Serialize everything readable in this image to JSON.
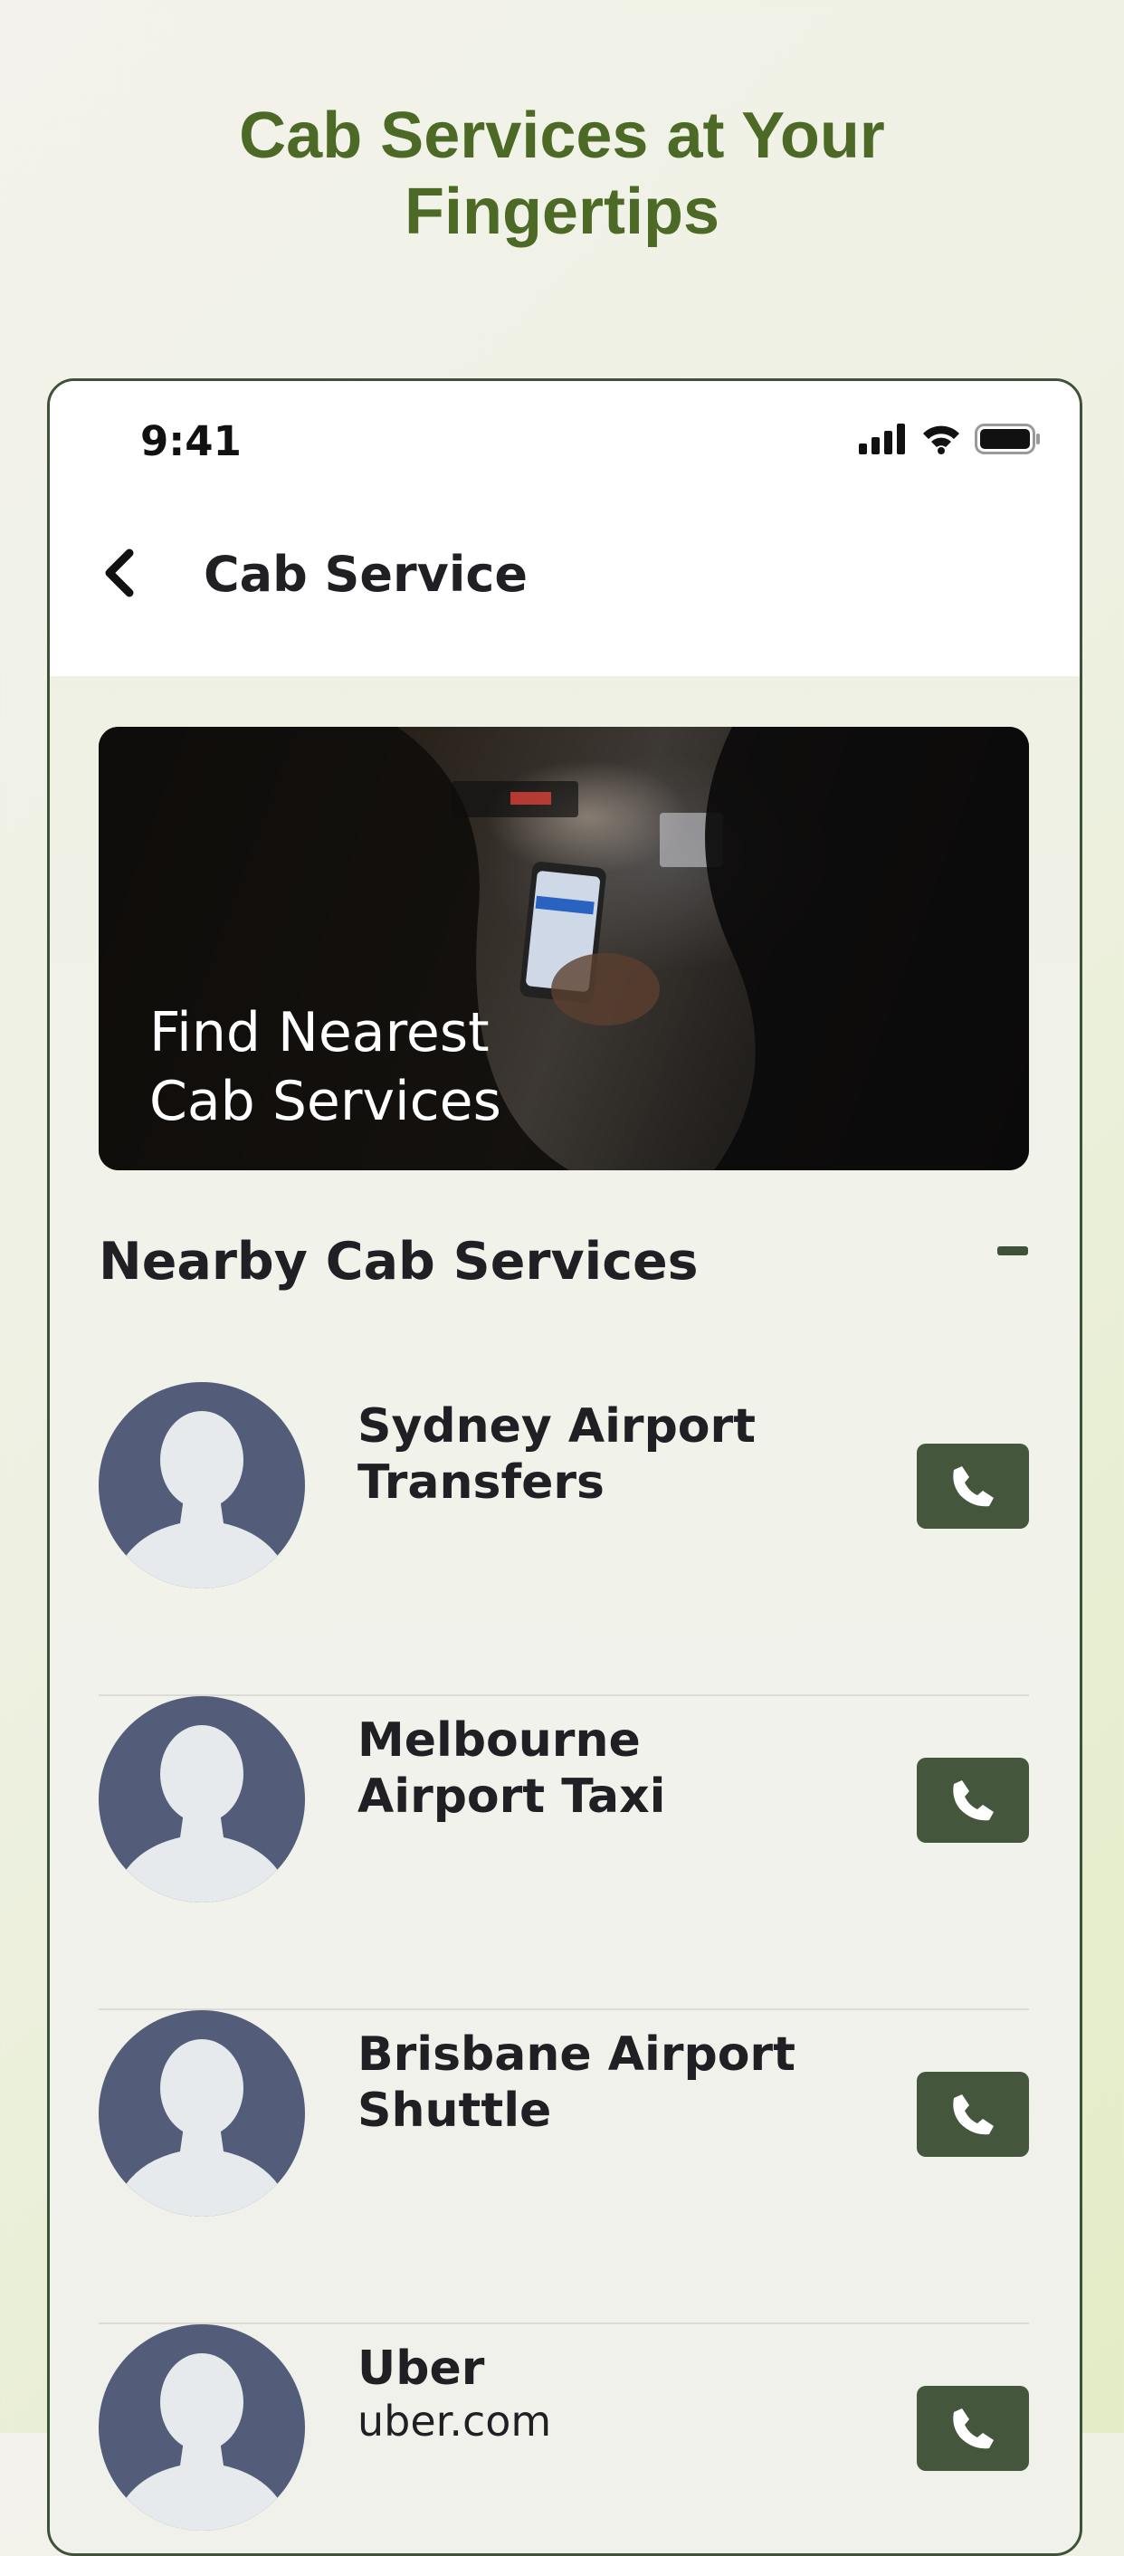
{
  "promo": {
    "title_line1": "Cab Services at Your",
    "title_line2": "Fingertips"
  },
  "status_bar": {
    "time": "9:41"
  },
  "nav": {
    "title": "Cab Service"
  },
  "hero": {
    "line1": "Find Nearest",
    "line2": "Cab Services"
  },
  "section": {
    "title": "Nearby Cab Services"
  },
  "services": [
    {
      "line1": "Sydney Airport",
      "line2": "Transfers",
      "url": ""
    },
    {
      "line1": "Melbourne",
      "line2": "Airport Taxi",
      "url": ""
    },
    {
      "line1": "Brisbane Airport",
      "line2": "Shuttle",
      "url": ""
    },
    {
      "line1": "Uber",
      "line2": "",
      "url": "uber.com"
    }
  ],
  "icons": {
    "back": "chevron-left-icon",
    "signal": "cellular-signal-icon",
    "wifi": "wifi-icon",
    "battery": "battery-icon",
    "collapse": "minus-icon",
    "avatar": "person-silhouette-icon",
    "call": "phone-icon"
  },
  "colors": {
    "accent_green": "#44573d",
    "title_green": "#4c6a26",
    "avatar_blue": "#535d7a",
    "text_dark": "#1f1f24"
  }
}
